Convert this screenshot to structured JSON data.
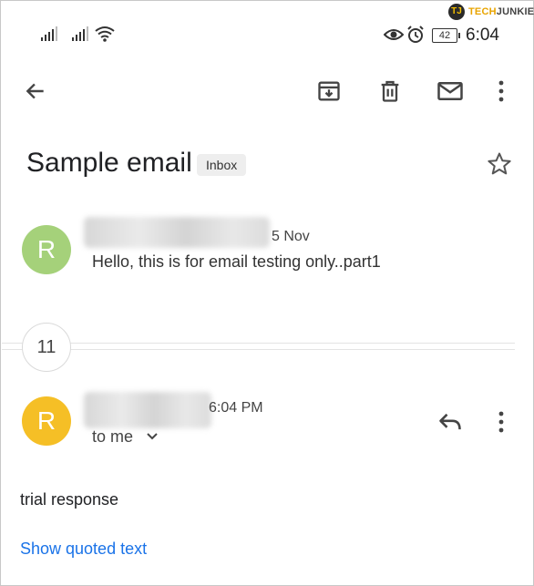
{
  "status_bar": {
    "time": "6:04",
    "battery": "42"
  },
  "watermark": {
    "brand_part1": "TECH",
    "brand_part2": "JUNKIE",
    "mark": "TJ"
  },
  "toolbar": {
    "back": "arrow-left-icon",
    "archive": "archive-icon",
    "delete": "trash-icon",
    "mark_unread": "mail-icon",
    "more": "more-vert-icon"
  },
  "thread": {
    "subject": "Sample email",
    "label": "Inbox",
    "collapsed_count": "11"
  },
  "messages": [
    {
      "avatar_letter": "R",
      "avatar_color": "#a5d17a",
      "date": "5 Nov",
      "snippet": "Hello, this is for email testing only..part1"
    },
    {
      "avatar_letter": "R",
      "avatar_color": "#f5bf26",
      "date": "6:04 PM",
      "to": "to me",
      "body": "trial response",
      "show_quoted": "Show quoted text"
    }
  ],
  "colors": {
    "link": "#1a73e8"
  }
}
